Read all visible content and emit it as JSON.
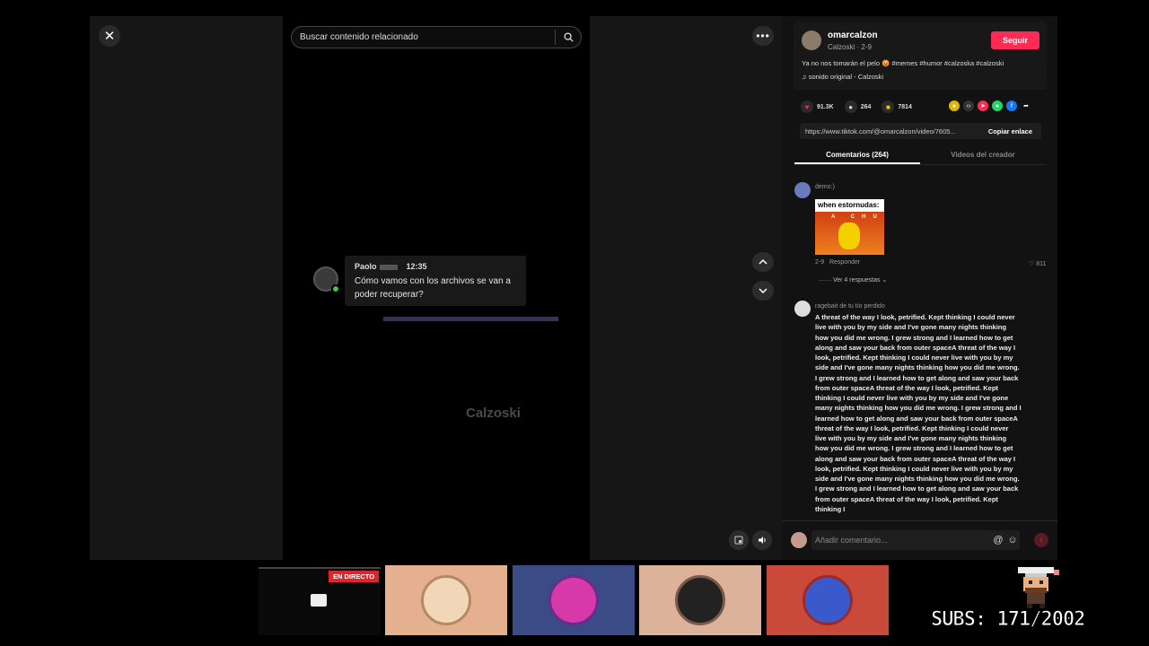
{
  "search": {
    "placeholder": "Buscar contenido relacionado"
  },
  "video": {
    "message": {
      "sender": "Paolo",
      "time": "12:35",
      "text": "Cómo vamos con los archivos se van a poder recuperar?"
    },
    "watermark": "Calzoski"
  },
  "profile": {
    "username": "omarcalzon",
    "subtitle": "Calzoski · 2-9",
    "follow_label": "Seguir",
    "description": "Ya no nos tomarán el pelo 😡 #memes #humor #calzoska #calzoski",
    "sound": "sonido original - Calzoski"
  },
  "stats": {
    "likes": "91.3K",
    "comments": "264",
    "saves": "7814"
  },
  "share": {
    "url": "https://www.tiktok.com/@omarcalzon/video/7605...",
    "copy_label": "Copiar enlace"
  },
  "tabs": {
    "comments": "Comentarios (264)",
    "creator_videos": "Videos del creador"
  },
  "comments": [
    {
      "user": "demo:)",
      "image_caption": "when estornudas:",
      "image_text": "A CHU",
      "date": "2-9",
      "reply_label": "Responder",
      "likes": "811",
      "view_replies": "Ver 4 respuestas"
    },
    {
      "user": "ragebait de tu tío perdido",
      "text": "A threat of the way I look, petrified. Kept thinking I could never live with you by my side and I've gone many nights thinking how you did me wrong. I grew strong and I learned how to get along and saw your back from outer spaceA threat of the way I look, petrified. Kept thinking I could never live with you by my side and I've gone many nights thinking how you did me wrong. I grew strong and I learned how to get along and saw your back from outer spaceA threat of the way I look, petrified. Kept thinking I could never live with you by my side and I've gone many nights thinking how you did me wrong. I grew strong and I learned how to get along and saw your back from outer spaceA threat of the way I look, petrified. Kept thinking I could never live with you by my side and I've gone many nights thinking how you did me wrong. I grew strong and I learned how to get along and saw your back from outer spaceA threat of the way I look, petrified. Kept thinking I could never live with you by my side and I've gone many nights thinking how you did me wrong. I grew strong and I learned how to get along and saw your back from outer spaceA threat of the way I look, petrified. Kept thinking I"
    }
  ],
  "comment_input": {
    "placeholder": "Añadir comentario..."
  },
  "stream": {
    "live_badge": "EN DIRECTO",
    "subs_counter": "SUBS: 171/2002"
  },
  "colors": {
    "accent": "#fe2c55",
    "live": "#e0242c",
    "background": "#000000"
  }
}
